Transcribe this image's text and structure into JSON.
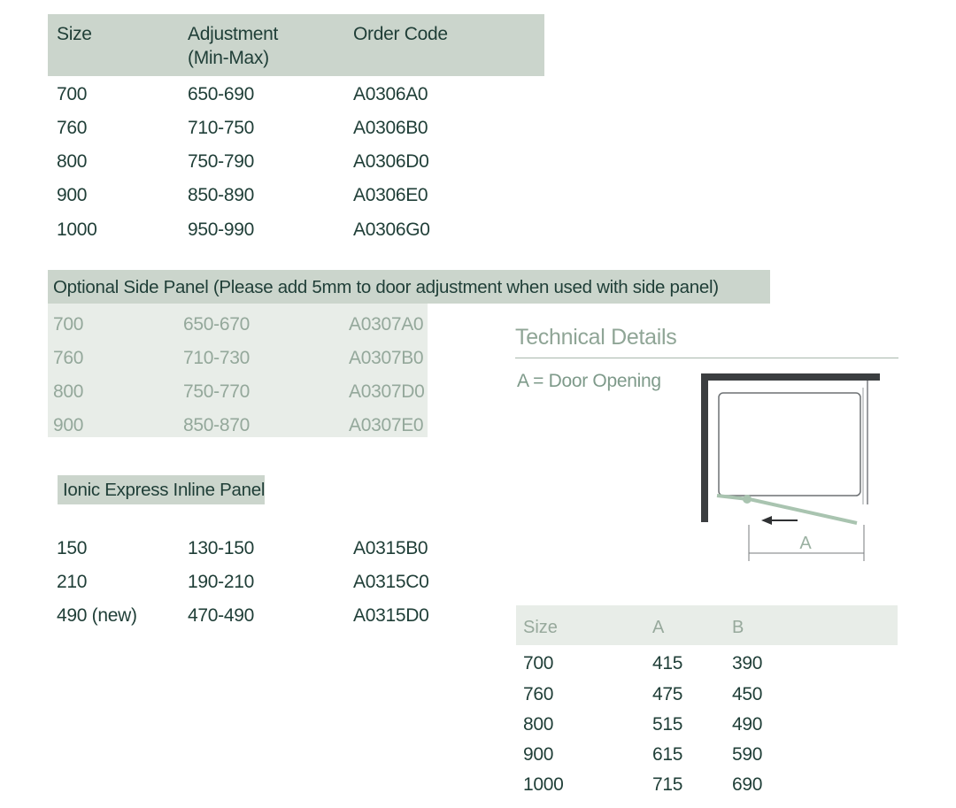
{
  "main_table": {
    "headers": [
      "Size",
      "Adjustment",
      "(Min-Max)",
      "Order Code"
    ],
    "rows": [
      [
        "700",
        "650-690",
        "A0306A0"
      ],
      [
        "760",
        "710-750",
        "A0306B0"
      ],
      [
        "800",
        "750-790",
        "A0306D0"
      ],
      [
        "900",
        "850-890",
        "A0306E0"
      ],
      [
        "1000",
        "950-990",
        "A0306G0"
      ]
    ]
  },
  "side_panel": {
    "title": "Optional Side Panel (Please add 5mm to door adjustment when used with side panel)",
    "rows": [
      [
        "700",
        "650-670",
        "A0307A0"
      ],
      [
        "760",
        "710-730",
        "A0307B0"
      ],
      [
        "800",
        "750-770",
        "A0307D0"
      ],
      [
        "900",
        "850-870",
        "A0307E0"
      ]
    ]
  },
  "inline_panel": {
    "title": "Ionic Express Inline Panel",
    "rows": [
      [
        "150",
        "130-150",
        "A0315B0"
      ],
      [
        "210",
        "190-210",
        "A0315C0"
      ],
      [
        "490 (new)",
        "470-490",
        "A0315D0"
      ]
    ]
  },
  "technical": {
    "title": "Technical Details",
    "legend": "A = Door Opening",
    "diagram_label": "A"
  },
  "dimension_table": {
    "headers": [
      "Size",
      "A",
      "B"
    ],
    "rows": [
      [
        "700",
        "415",
        "390"
      ],
      [
        "760",
        "475",
        "450"
      ],
      [
        "800",
        "515",
        "490"
      ],
      [
        "900",
        "615",
        "590"
      ],
      [
        "1000",
        "715",
        "690"
      ]
    ]
  },
  "colors": {
    "header_bg": "#cbd5cc",
    "panel_bg": "#e8ede8",
    "text_dark": "#1f3e37",
    "text_muted": "#94a89b",
    "frame": "#3a3d3f",
    "glass": "#a8c2ae"
  }
}
